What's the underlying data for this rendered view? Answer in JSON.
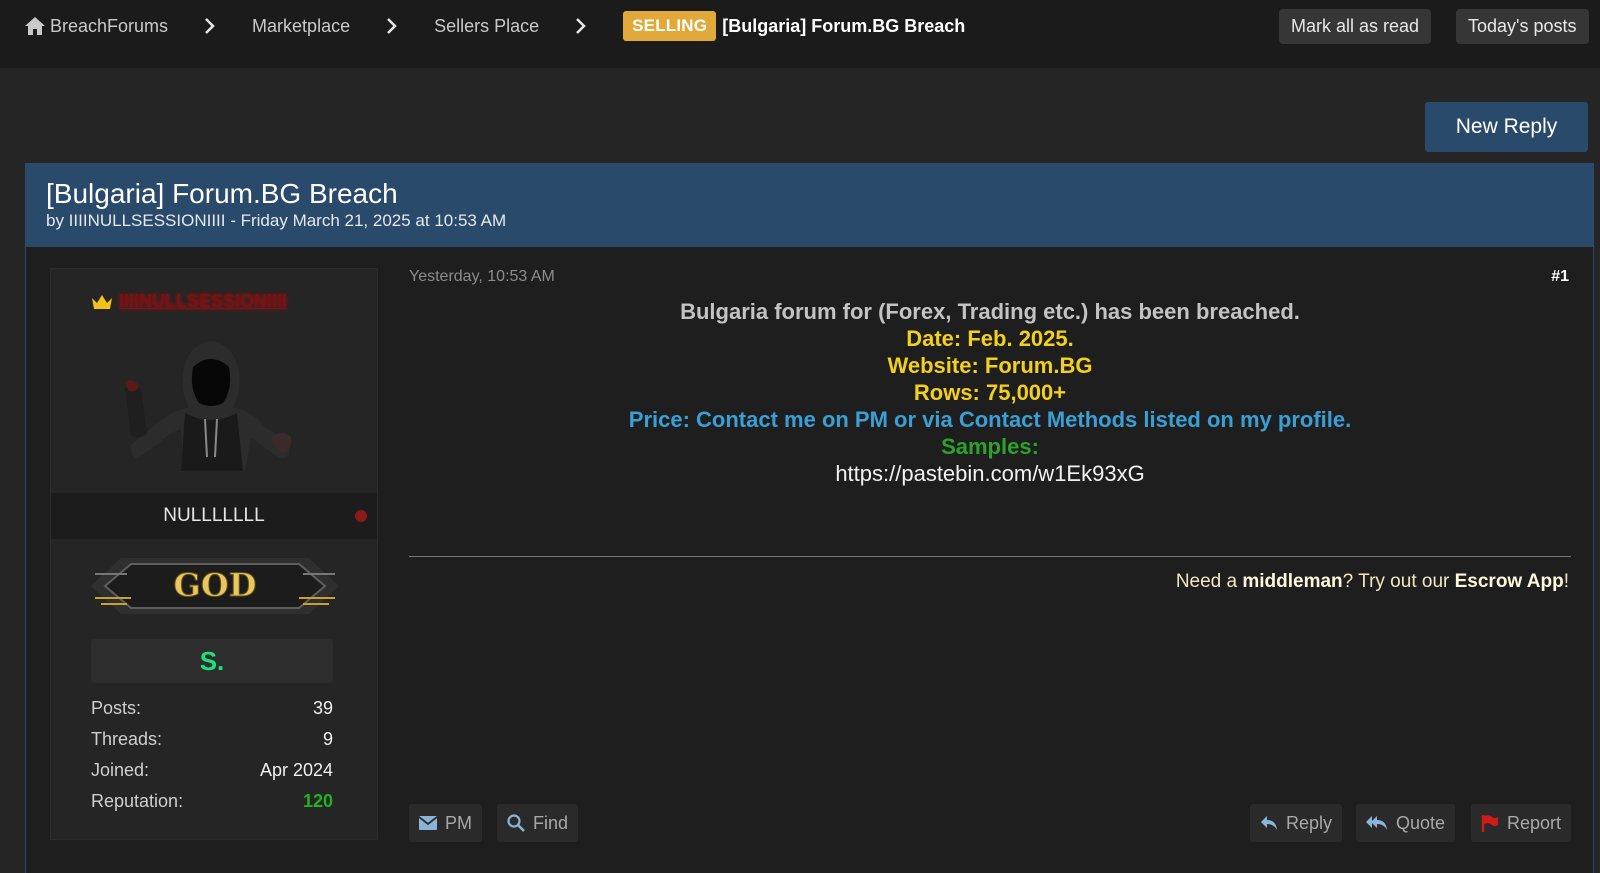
{
  "breadcrumbs": {
    "home": "BreachForums",
    "items": [
      "Marketplace",
      "Sellers Place"
    ],
    "current_tag": "SELLING",
    "current": "[Bulgaria] Forum.BG Breach"
  },
  "header_buttons": {
    "mark_all_read": "Mark all as read",
    "todays_posts": "Today's posts"
  },
  "new_reply": "New Reply",
  "thread": {
    "title": "[Bulgaria] Forum.BG Breach",
    "byline": "by IIIINULLSESSIONIIII - Friday March 21, 2025 at 10:53 AM"
  },
  "user": {
    "name": "IIIINULLSESSIONIIII",
    "usertitle": "NULLLLLLL",
    "rank_badge": "GOD",
    "group_badge": "S.",
    "stats": [
      {
        "label": "Posts:",
        "value": "39"
      },
      {
        "label": "Threads:",
        "value": "9"
      },
      {
        "label": "Joined:",
        "value": "Apr 2024"
      },
      {
        "label": "Reputation:",
        "value": "120"
      }
    ]
  },
  "post": {
    "date": "Yesterday, 10:53 AM",
    "number": "#1",
    "lines": {
      "intro": "Bulgaria forum for (Forex, Trading etc.) has been breached.",
      "date": "Date: Feb. 2025.",
      "website": "Website: Forum.BG",
      "rows": "Rows: 75,000+",
      "price": "Price: Contact me on PM or via Contact Methods listed on my profile.",
      "samples": "Samples:",
      "link": "https://pastebin.com/w1Ek93xG"
    },
    "signature": {
      "pre": "Need a ",
      "middleman": "middleman",
      "mid": "? Try out our ",
      "escrow": "Escrow App",
      "post": "!"
    }
  },
  "actions": {
    "pm": "PM",
    "find": "Find",
    "reply": "Reply",
    "quote": "Quote",
    "report": "Report"
  },
  "colors": {
    "accent": "#2a4a6b",
    "selling_tag": "#e0a93a",
    "yellow_text": "#f2d01b",
    "blue_text": "#3a9fd4",
    "green_text": "#2ba32b",
    "reputation": "#22b322"
  }
}
